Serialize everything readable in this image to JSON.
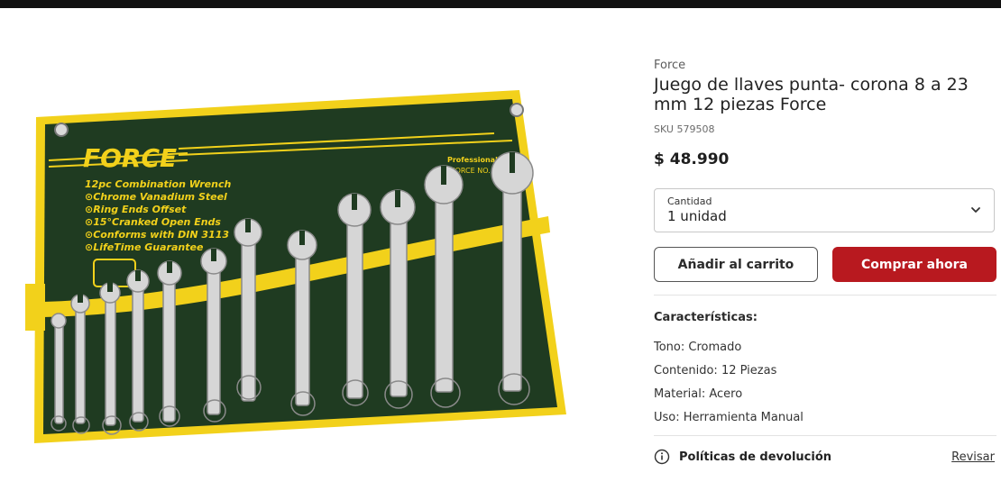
{
  "product": {
    "brand": "Force",
    "title": "Juego de llaves punta- corona 8 a 23 mm 12 piezas Force",
    "sku": "SKU 579508",
    "price": "$ 48.990",
    "image": {
      "brand_text": "FORCE",
      "pouch_title": "Professional Tool",
      "pouch_model": "FORCE NO. 5121",
      "pouch_lines": [
        "12pc  Combination Wrench",
        "⊙Chrome Vanadium Steel",
        "⊙Ring Ends Offset",
        "⊙15°Cranked Open Ends",
        "⊙Conforms with DIN 3113",
        "⊙LifeTime Guarantee"
      ],
      "icon": "wrench-set-photo"
    }
  },
  "quantity": {
    "label": "Cantidad",
    "value": "1 unidad",
    "icon": "chevron-down-icon"
  },
  "actions": {
    "add_to_cart": "Añadir al carrito",
    "buy_now": "Comprar ahora"
  },
  "features": {
    "title": "Características:",
    "items": [
      {
        "key": "Tono:",
        "value": "Cromado"
      },
      {
        "key": "Contenido:",
        "value": "12 Piezas"
      },
      {
        "key": "Material:",
        "value": "Acero"
      },
      {
        "key": "Uso:",
        "value": "Herramienta Manual"
      }
    ]
  },
  "returns": {
    "label": "Políticas de devolución",
    "link": "Revisar",
    "icon": "info-icon"
  },
  "colors": {
    "accent": "#b8191f",
    "pouch": "#1f3b21",
    "binding": "#f2d11b"
  }
}
